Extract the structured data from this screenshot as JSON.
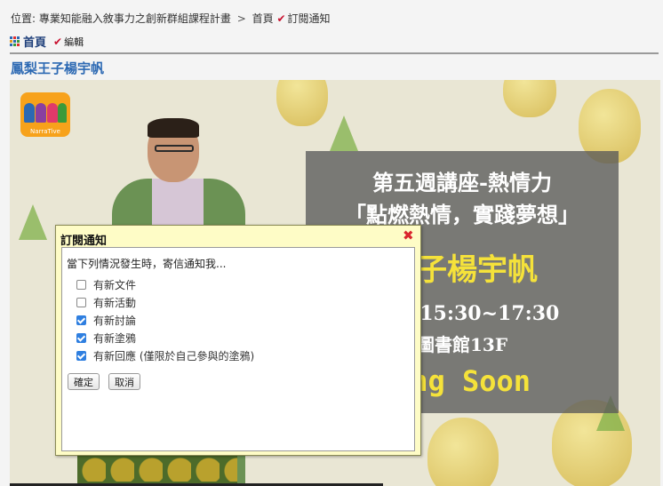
{
  "breadcrumb": {
    "prefix": "位置:",
    "course": "專業知能融入敘事力之創新群組課程計畫",
    "separator": ">",
    "home": "首頁",
    "current": "訂閱通知"
  },
  "topnav": {
    "home_label": "首頁",
    "edit_label": "編輯"
  },
  "page_title": "鳳梨王子楊宇帆",
  "banner": {
    "logo_text": "NarraTive",
    "line1": "第五週講座-熱情力",
    "line2": "「點燃熱情，實踐夢想」",
    "line3": "王子楊宇帆",
    "line4": "0/14 15:30~17:30",
    "line5": "圖書館13F",
    "line6": "ing Soon"
  },
  "dialog": {
    "title": "訂閱通知",
    "prompt": "當下列情況發生時，寄信通知我...",
    "options": [
      {
        "label": "有新文件",
        "checked": false
      },
      {
        "label": "有新活動",
        "checked": false
      },
      {
        "label": "有新討論",
        "checked": true
      },
      {
        "label": "有新塗鴉",
        "checked": true
      },
      {
        "label": "有新回應 (僅限於自己參與的塗鴉)",
        "checked": true
      }
    ],
    "confirm_label": "確定",
    "cancel_label": "取消"
  },
  "colors": {
    "title_blue": "#2c69b3",
    "checkbox_blue": "#2f7fe0",
    "close_red": "#d9262e",
    "dialog_bg": "#fefcc6"
  }
}
